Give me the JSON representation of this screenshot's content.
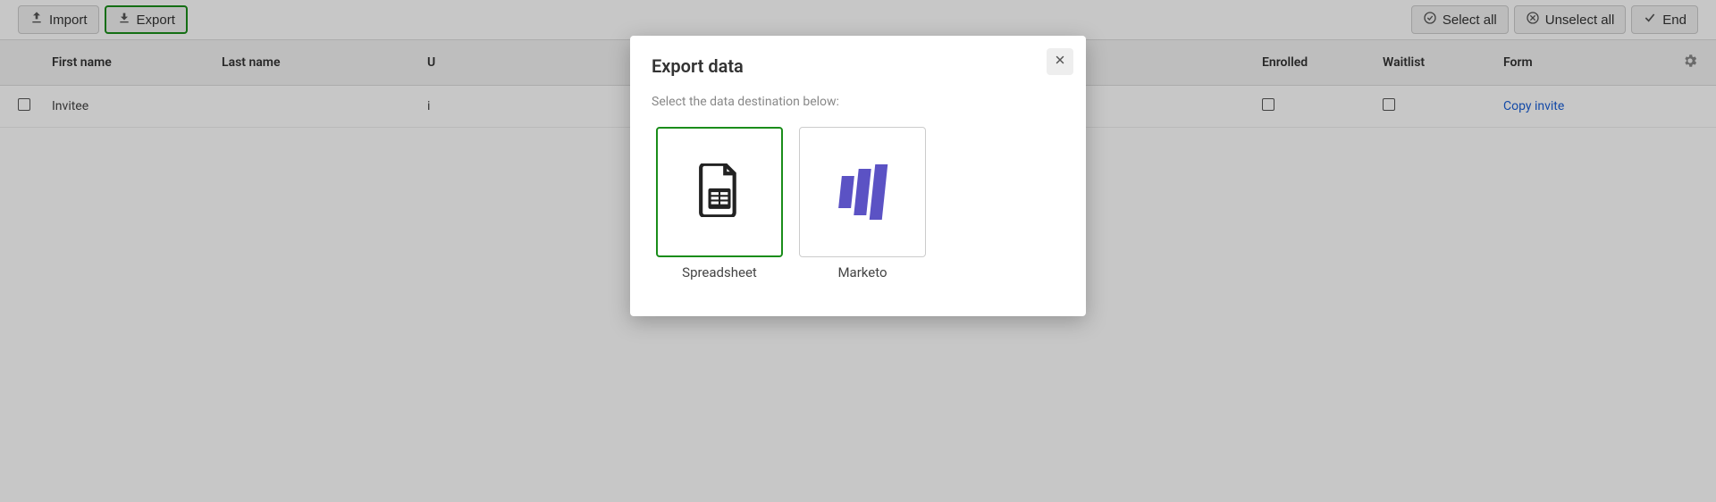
{
  "toolbar": {
    "import_label": "Import",
    "export_label": "Export",
    "select_all_label": "Select all",
    "unselect_all_label": "Unselect all",
    "end_label": "End"
  },
  "columns": {
    "first_name": "First name",
    "last_name": "Last name",
    "user": "U",
    "enrolled": "Enrolled",
    "waitlist": "Waitlist",
    "form": "Form"
  },
  "row": {
    "first_name": "Invitee",
    "last_name": "",
    "user_preview": "i",
    "form_action": "Copy invite"
  },
  "modal": {
    "title": "Export data",
    "instruction": "Select the data destination below:",
    "destinations": [
      {
        "label": "Spreadsheet"
      },
      {
        "label": "Marketo"
      }
    ]
  }
}
